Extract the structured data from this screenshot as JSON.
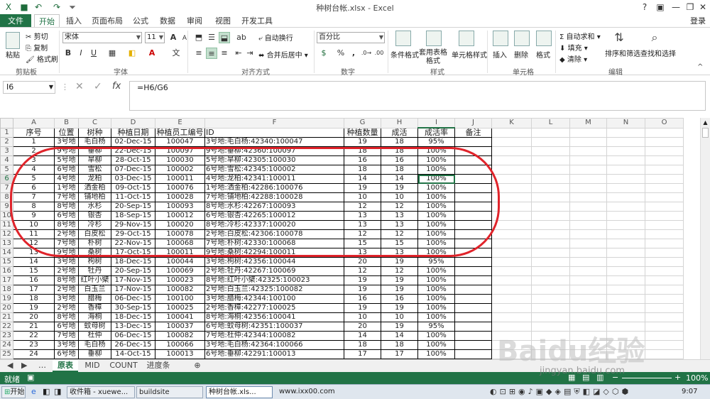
{
  "window": {
    "title": "种树台帐.xlsx - Excel",
    "help": "?",
    "login": "登录"
  },
  "quick_access": {
    "save_icon": "save-icon",
    "undo_icon": "undo-icon",
    "redo_icon": "redo-icon"
  },
  "tabs": [
    {
      "label": "文件"
    },
    {
      "label": "开始"
    },
    {
      "label": "插入"
    },
    {
      "label": "页面布局"
    },
    {
      "label": "公式"
    },
    {
      "label": "数据"
    },
    {
      "label": "审阅"
    },
    {
      "label": "视图"
    },
    {
      "label": "开发工具"
    }
  ],
  "ribbon": {
    "clipboard": {
      "paste": "粘贴",
      "cut": "剪切",
      "copy": "复制",
      "format_painter": "格式刷",
      "label": "剪贴板"
    },
    "font": {
      "name": "宋体",
      "size": "11",
      "bold": "B",
      "italic": "I",
      "underline": "U",
      "label": "字体",
      "grow": "A",
      "shrink": "A"
    },
    "alignment": {
      "wrap": "自动换行",
      "merge": "合并后居中",
      "label": "对齐方式"
    },
    "number": {
      "format": "百分比",
      "percent": "%",
      "comma": ",",
      "label": "数字"
    },
    "styles": {
      "conditional": "条件格式",
      "table_fmt": "套用表格格式",
      "cell_styles": "单元格样式",
      "label": "样式"
    },
    "cells": {
      "insert": "插入",
      "delete": "删除",
      "format": "格式",
      "label": "单元格"
    },
    "editing": {
      "autosum": "自动求和",
      "fill": "填充",
      "clear": "清除",
      "sort": "排序和筛选",
      "find": "查找和选择",
      "label": "编辑"
    }
  },
  "formula_bar": {
    "name_box": "I6",
    "formula": "=H6/G6",
    "fx": "fx"
  },
  "columns": [
    "A",
    "B",
    "C",
    "D",
    "E",
    "F",
    "G",
    "H",
    "I",
    "J",
    "K",
    "L",
    "M",
    "N",
    "O"
  ],
  "header_row": [
    "序号",
    "位置",
    "树种",
    "种植日期",
    "种植员工编号",
    "ID",
    "种植数量",
    "成活",
    "成活率",
    "备注"
  ],
  "rows": [
    [
      "1",
      "3号地",
      "毛白杨",
      "02-Dec-15",
      "100047",
      "3号地:毛白杨:42340:100047",
      "19",
      "18",
      "95%",
      ""
    ],
    [
      "2",
      "9号地",
      "垂柳",
      "22-Dec-15",
      "100097",
      "9号地:垂柳:42360:100097",
      "18",
      "18",
      "100%",
      ""
    ],
    [
      "3",
      "5号地",
      "旱柳",
      "28-Oct-15",
      "100030",
      "5号地:旱柳:42305:100030",
      "16",
      "16",
      "100%",
      ""
    ],
    [
      "4",
      "6号地",
      "雪松",
      "07-Dec-15",
      "100002",
      "6号地:雪松:42345:100002",
      "18",
      "18",
      "100%",
      ""
    ],
    [
      "5",
      "4号地",
      "龙柏",
      "03-Dec-15",
      "100011",
      "4号地:龙柏:42341:100011",
      "14",
      "14",
      "100%",
      ""
    ],
    [
      "6",
      "1号地",
      "洒金柏",
      "09-Oct-15",
      "100076",
      "1号地:洒金柏:42286:100076",
      "19",
      "19",
      "100%",
      ""
    ],
    [
      "7",
      "7号地",
      "铺地柏",
      "11-Oct-15",
      "100028",
      "7号地:铺地柏:42288:100028",
      "10",
      "10",
      "100%",
      ""
    ],
    [
      "8",
      "8号地",
      "水杉",
      "20-Sep-15",
      "100093",
      "8号地:水杉:42267:100093",
      "12",
      "12",
      "100%",
      ""
    ],
    [
      "9",
      "6号地",
      "银杏",
      "18-Sep-15",
      "100012",
      "6号地:银杏:42265:100012",
      "13",
      "13",
      "100%",
      ""
    ],
    [
      "10",
      "8号地",
      "冷杉",
      "29-Nov-15",
      "100020",
      "8号地:冷杉:42337:100020",
      "13",
      "13",
      "100%",
      ""
    ],
    [
      "11",
      "2号地",
      "白皮松",
      "29-Oct-15",
      "100078",
      "2号地:白皮松:42306:100078",
      "12",
      "12",
      "100%",
      ""
    ],
    [
      "12",
      "7号地",
      "朴树",
      "22-Nov-15",
      "100068",
      "7号地:朴树:42330:100068",
      "15",
      "15",
      "100%",
      ""
    ],
    [
      "13",
      "9号地",
      "桑树",
      "17-Oct-15",
      "100011",
      "9号地:桑树:42294:100011",
      "13",
      "13",
      "100%",
      ""
    ],
    [
      "14",
      "3号地",
      "枸树",
      "18-Dec-15",
      "100044",
      "3号地:枸树:42356:100044",
      "20",
      "19",
      "95%",
      ""
    ],
    [
      "15",
      "2号地",
      "牡丹",
      "20-Sep-15",
      "100069",
      "2号地:牡丹:42267:100069",
      "12",
      "12",
      "100%",
      ""
    ],
    [
      "16",
      "8号地",
      "红叶小檗",
      "17-Nov-15",
      "100023",
      "8号地:红叶小檗:42325:100023",
      "19",
      "19",
      "100%",
      ""
    ],
    [
      "17",
      "2号地",
      "白玉兰",
      "17-Nov-15",
      "100082",
      "2号地:白玉兰:42325:100082",
      "19",
      "19",
      "100%",
      ""
    ],
    [
      "18",
      "3号地",
      "腊梅",
      "06-Dec-15",
      "100100",
      "3号地:腊梅:42344:100100",
      "16",
      "16",
      "100%",
      ""
    ],
    [
      "19",
      "2号地",
      "香樟",
      "30-Sep-15",
      "100025",
      "2号地:香樟:42277:100025",
      "19",
      "19",
      "100%",
      ""
    ],
    [
      "20",
      "8号地",
      "海桐",
      "18-Dec-15",
      "100041",
      "8号地:海桐:42356:100041",
      "10",
      "10",
      "100%",
      ""
    ],
    [
      "21",
      "6号地",
      "蚊母树",
      "13-Dec-15",
      "100037",
      "6号地:蚊母树:42351:100037",
      "20",
      "19",
      "95%",
      ""
    ],
    [
      "22",
      "7号地",
      "杜仲",
      "06-Dec-15",
      "100082",
      "7号地:杜仲:42344:100082",
      "14",
      "14",
      "100%",
      ""
    ],
    [
      "23",
      "3号地",
      "毛白杨",
      "26-Dec-15",
      "100066",
      "3号地:毛白杨:42364:100066",
      "18",
      "18",
      "100%",
      ""
    ],
    [
      "24",
      "6号地",
      "垂柳",
      "14-Oct-15",
      "100013",
      "6号地:垂柳:42291:100013",
      "17",
      "17",
      "100%",
      ""
    ]
  ],
  "sheet_tabs": [
    {
      "label": "原表"
    },
    {
      "label": "MID"
    },
    {
      "label": "COUNT"
    },
    {
      "label": "进度条"
    }
  ],
  "status": {
    "ready": "就绪",
    "zoom": "100%"
  },
  "taskbar": {
    "start": "开始",
    "items": [
      {
        "label": "收件箱 - xuewe..."
      },
      {
        "label": "buildsite"
      },
      {
        "label": "种树台帐.xls..."
      },
      {
        "label": "www.ixx00.com"
      }
    ],
    "clock": "9:07"
  },
  "watermark": {
    "brand": "Baidu经验",
    "url": "jingyan.baidu.com"
  },
  "colors": {
    "accent": "#217346",
    "annotation": "#e0242b"
  }
}
